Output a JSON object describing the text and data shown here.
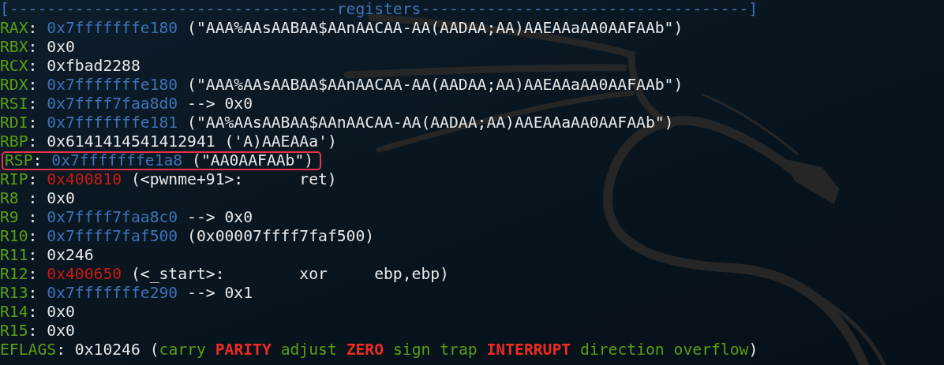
{
  "header": {
    "left": "[-----------------------------------",
    "title": "registers",
    "right": "-----------------------------------]"
  },
  "registers": [
    {
      "name": "RAX",
      "sep": ": ",
      "value": "0x7fffffffe180",
      "kind": "pointer",
      "detail": " (\"AAA%AAsAABAA$AAnAACAA-AA(AADAA;AA)AAEAAaAA0AAFAAb\")",
      "highlighted": false
    },
    {
      "name": "RBX",
      "sep": ": ",
      "value": "0x0",
      "kind": "plain",
      "highlighted": false
    },
    {
      "name": "RCX",
      "sep": ": ",
      "value": "0xfbad2288",
      "kind": "plain",
      "highlighted": false
    },
    {
      "name": "RDX",
      "sep": ": ",
      "value": "0x7fffffffe180",
      "kind": "pointer",
      "detail": " (\"AAA%AAsAABAA$AAnAACAA-AA(AADAA;AA)AAEAAaAA0AAFAAb\")",
      "highlighted": false
    },
    {
      "name": "RSI",
      "sep": ": ",
      "value": "0x7ffff7faa8d0",
      "kind": "pointer",
      "detail": " --> 0x0",
      "highlighted": false
    },
    {
      "name": "RDI",
      "sep": ": ",
      "value": "0x7fffffffe181",
      "kind": "pointer",
      "detail": " (\"AA%AAsAABAA$AAnAACAA-AA(AADAA;AA)AAEAAaAA0AAFAAb\")",
      "highlighted": false
    },
    {
      "name": "RBP",
      "sep": ": ",
      "value": "0x6141414541412941",
      "kind": "plain",
      "detail": " ('A)AAEAAa')",
      "highlighted": false
    },
    {
      "name": "RSP",
      "sep": ": ",
      "value": "0x7fffffffe1a8",
      "kind": "pointer",
      "detail": " (\"AA0AAFAAb\")",
      "highlighted": true
    },
    {
      "name": "RIP",
      "sep": ": ",
      "value": "0x400810",
      "kind": "code",
      "detail": " (<pwnme+91>:      ret)",
      "highlighted": false
    },
    {
      "name": "R8",
      "sep": " : ",
      "value": "0x0",
      "kind": "plain",
      "highlighted": false
    },
    {
      "name": "R9",
      "sep": " : ",
      "value": "0x7ffff7faa8c0",
      "kind": "pointer",
      "detail": " --> 0x0",
      "highlighted": false
    },
    {
      "name": "R10",
      "sep": ": ",
      "value": "0x7ffff7faf500",
      "kind": "pointer",
      "detail": " (0x00007ffff7faf500)",
      "highlighted": false
    },
    {
      "name": "R11",
      "sep": ": ",
      "value": "0x246",
      "kind": "plain",
      "highlighted": false
    },
    {
      "name": "R12",
      "sep": ": ",
      "value": "0x400650",
      "kind": "code",
      "detail": " (<_start>:        xor     ebp,ebp)",
      "highlighted": false
    },
    {
      "name": "R13",
      "sep": ": ",
      "value": "0x7fffffffe290",
      "kind": "pointer",
      "detail": " --> 0x1",
      "highlighted": false
    },
    {
      "name": "R14",
      "sep": ": ",
      "value": "0x0",
      "kind": "plain",
      "highlighted": false
    },
    {
      "name": "R15",
      "sep": ": ",
      "value": "0x0",
      "kind": "plain",
      "highlighted": false
    }
  ],
  "eflags": {
    "name": "EFLAGS",
    "sep": ": ",
    "value": "0x10246",
    "open": " (",
    "close": ")",
    "flags": [
      {
        "name": "carry",
        "set": false
      },
      {
        "name": "PARITY",
        "set": true
      },
      {
        "name": "adjust",
        "set": false
      },
      {
        "name": "ZERO",
        "set": true
      },
      {
        "name": "sign",
        "set": false
      },
      {
        "name": "trap",
        "set": false
      },
      {
        "name": "INTERRUPT",
        "set": true
      },
      {
        "name": "direction",
        "set": false
      },
      {
        "name": "overflow",
        "set": false
      }
    ]
  }
}
